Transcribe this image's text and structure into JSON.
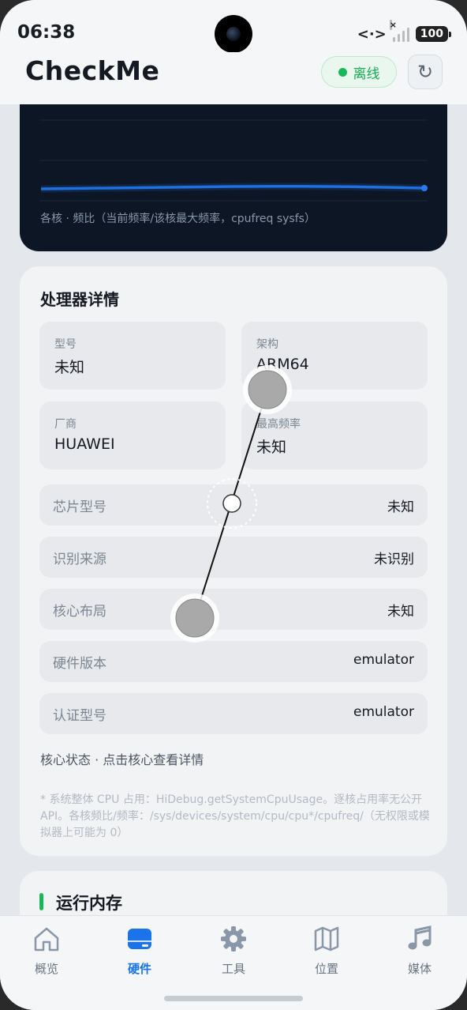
{
  "status_bar": {
    "time": "06:38",
    "battery": "100"
  },
  "header": {
    "title": "CheckMe",
    "status_label": "离线",
    "refresh_icon": "refresh-icon"
  },
  "chart_card": {
    "caption": "各核 · 频比（当前频率/该核最大频率，cpufreq sysfs）"
  },
  "processor": {
    "title": "处理器详情",
    "tiles": [
      {
        "label": "型号",
        "value": "未知"
      },
      {
        "label": "架构",
        "value": "ARM64"
      },
      {
        "label": "厂商",
        "value": "HUAWEI"
      },
      {
        "label": "最高频率",
        "value": "未知"
      }
    ],
    "rows": [
      {
        "label": "芯片型号",
        "value": "未知"
      },
      {
        "label": "识别来源",
        "value": "未识别"
      },
      {
        "label": "核心布局",
        "value": "未知"
      },
      {
        "label": "硬件版本",
        "value": "emulator"
      },
      {
        "label": "认证型号",
        "value": "emulator"
      }
    ],
    "core_status": "核心状态 · 点击核心查看详情",
    "footnote": "* 系统整体 CPU 占用：HiDebug.getSystemCpuUsage。逐核占用率无公开 API。各核频比/频率：/sys/devices/system/cpu/cpu*/cpufreq/（无权限或模拟器上可能为 0）"
  },
  "memory_card": {
    "title": "运行内存"
  },
  "tabs": [
    {
      "label": "概览",
      "icon": "home-icon"
    },
    {
      "label": "硬件",
      "icon": "storage-icon"
    },
    {
      "label": "工具",
      "icon": "gear-icon"
    },
    {
      "label": "位置",
      "icon": "map-icon"
    },
    {
      "label": "媒体",
      "icon": "music-note-icon"
    }
  ],
  "active_tab": "硬件",
  "colors": {
    "accent": "#1a73e8",
    "online_green": "#18b85a",
    "chart_bg": "#0c1624",
    "chart_line": "#1f6fe0"
  }
}
